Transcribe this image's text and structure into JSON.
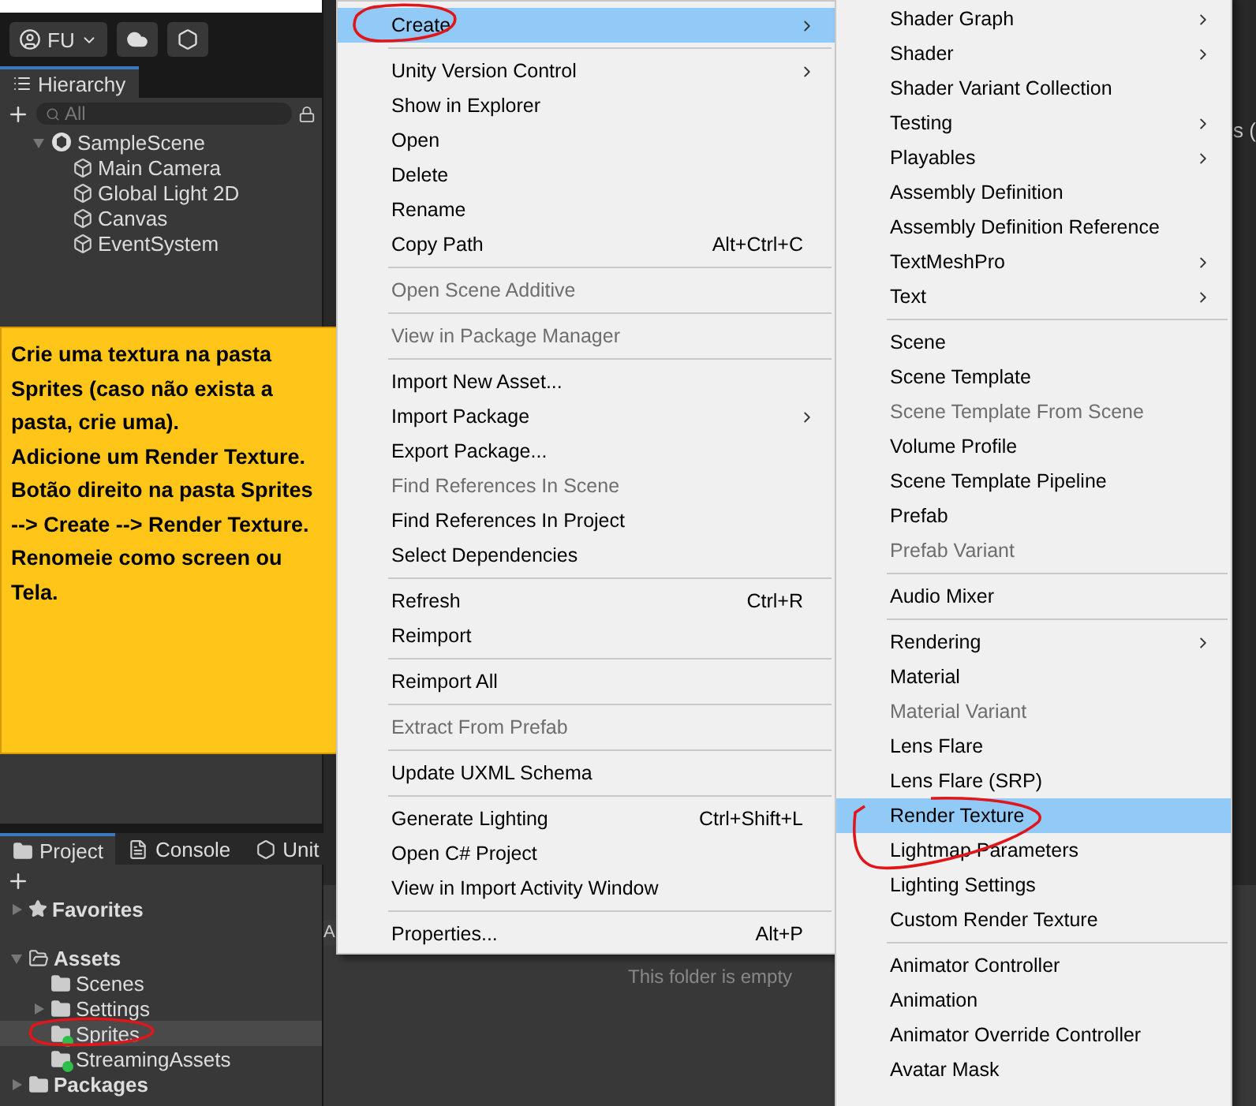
{
  "toolbar": {
    "account": "FU"
  },
  "hierarchy": {
    "tab": "Hierarchy",
    "search": {
      "placeholder": "All"
    },
    "tree": [
      {
        "label": "SampleScene",
        "kind": "scene",
        "expanded": true,
        "children": [
          {
            "label": "Main Camera",
            "kind": "object"
          },
          {
            "label": "Global Light 2D",
            "kind": "object"
          },
          {
            "label": "Canvas",
            "kind": "object"
          },
          {
            "label": "EventSystem",
            "kind": "object"
          }
        ]
      }
    ]
  },
  "note": {
    "paragraphs": [
      "Crie uma textura na pasta Sprites (caso não exista a pasta, crie uma).",
      "Adicione um Render Texture.",
      "Botão direito na pasta Sprites --> Create --> Render Texture.",
      "Renomeie como screen ou Tela."
    ]
  },
  "project": {
    "tabs": [
      {
        "label": "Project",
        "selected": true
      },
      {
        "label": "Console",
        "selected": false
      },
      {
        "label": "Unit",
        "selected": false
      }
    ],
    "tree": [
      {
        "label": "Favorites",
        "kind": "star",
        "expanded": false,
        "selected": false
      },
      {
        "label": "Assets",
        "kind": "folder",
        "expanded": true,
        "selected": false,
        "children": [
          {
            "label": "Scenes",
            "kind": "folder",
            "selected": false
          },
          {
            "label": "Settings",
            "kind": "folder",
            "expanded": false,
            "selected": false
          },
          {
            "label": "Sprites",
            "kind": "folder",
            "selected": true,
            "badge": true
          },
          {
            "label": "StreamingAssets",
            "kind": "folder",
            "selected": false,
            "badge": true
          }
        ]
      },
      {
        "label": "Packages",
        "kind": "folder",
        "expanded": false,
        "selected": false
      }
    ],
    "side_header": "A",
    "empty_message": "This folder is empty"
  },
  "scene_view": {
    "tab_fragment": "s ("
  },
  "context_menu": {
    "groups": [
      [
        {
          "label": "Create",
          "submenu": true,
          "selected": true,
          "disabled": false
        }
      ],
      [
        {
          "label": "Unity Version Control",
          "submenu": true,
          "selected": false,
          "disabled": false
        },
        {
          "label": "Show in Explorer",
          "selected": false,
          "disabled": false
        },
        {
          "label": "Open",
          "selected": false,
          "disabled": false
        },
        {
          "label": "Delete",
          "selected": false,
          "disabled": false
        },
        {
          "label": "Rename",
          "selected": false,
          "disabled": false
        },
        {
          "label": "Copy Path",
          "shortcut": "Alt+Ctrl+C",
          "selected": false,
          "disabled": false
        }
      ],
      [
        {
          "label": "Open Scene Additive",
          "selected": false,
          "disabled": true
        }
      ],
      [
        {
          "label": "View in Package Manager",
          "selected": false,
          "disabled": true
        }
      ],
      [
        {
          "label": "Import New Asset...",
          "selected": false,
          "disabled": false
        },
        {
          "label": "Import Package",
          "submenu": true,
          "selected": false,
          "disabled": false
        },
        {
          "label": "Export Package...",
          "selected": false,
          "disabled": false
        },
        {
          "label": "Find References In Scene",
          "selected": false,
          "disabled": true
        },
        {
          "label": "Find References In Project",
          "selected": false,
          "disabled": false
        },
        {
          "label": "Select Dependencies",
          "selected": false,
          "disabled": false
        }
      ],
      [
        {
          "label": "Refresh",
          "shortcut": "Ctrl+R",
          "selected": false,
          "disabled": false
        },
        {
          "label": "Reimport",
          "selected": false,
          "disabled": false
        }
      ],
      [
        {
          "label": "Reimport All",
          "selected": false,
          "disabled": false
        }
      ],
      [
        {
          "label": "Extract From Prefab",
          "selected": false,
          "disabled": true
        }
      ],
      [
        {
          "label": "Update UXML Schema",
          "selected": false,
          "disabled": false
        }
      ],
      [
        {
          "label": "Generate Lighting",
          "shortcut": "Ctrl+Shift+L",
          "selected": false,
          "disabled": false
        },
        {
          "label": "Open C# Project",
          "selected": false,
          "disabled": false
        },
        {
          "label": "View in Import Activity Window",
          "selected": false,
          "disabled": false
        }
      ],
      [
        {
          "label": "Properties...",
          "shortcut": "Alt+P",
          "selected": false,
          "disabled": false
        }
      ]
    ]
  },
  "create_submenu": {
    "groups": [
      [
        {
          "label": "Shader Graph",
          "submenu": true,
          "selected": false,
          "disabled": false
        },
        {
          "label": "Shader",
          "submenu": true,
          "selected": false,
          "disabled": false
        },
        {
          "label": "Shader Variant Collection",
          "selected": false,
          "disabled": false
        },
        {
          "label": "Testing",
          "submenu": true,
          "selected": false,
          "disabled": false
        },
        {
          "label": "Playables",
          "submenu": true,
          "selected": false,
          "disabled": false
        },
        {
          "label": "Assembly Definition",
          "selected": false,
          "disabled": false
        },
        {
          "label": "Assembly Definition Reference",
          "selected": false,
          "disabled": false
        },
        {
          "label": "TextMeshPro",
          "submenu": true,
          "selected": false,
          "disabled": false
        },
        {
          "label": "Text",
          "submenu": true,
          "selected": false,
          "disabled": false
        }
      ],
      [
        {
          "label": "Scene",
          "selected": false,
          "disabled": false
        },
        {
          "label": "Scene Template",
          "selected": false,
          "disabled": false
        },
        {
          "label": "Scene Template From Scene",
          "selected": false,
          "disabled": true
        },
        {
          "label": "Volume Profile",
          "selected": false,
          "disabled": false
        },
        {
          "label": "Scene Template Pipeline",
          "selected": false,
          "disabled": false
        },
        {
          "label": "Prefab",
          "selected": false,
          "disabled": false
        },
        {
          "label": "Prefab Variant",
          "selected": false,
          "disabled": true
        }
      ],
      [
        {
          "label": "Audio Mixer",
          "selected": false,
          "disabled": false
        }
      ],
      [
        {
          "label": "Rendering",
          "submenu": true,
          "selected": false,
          "disabled": false
        },
        {
          "label": "Material",
          "selected": false,
          "disabled": false
        },
        {
          "label": "Material Variant",
          "selected": false,
          "disabled": true
        },
        {
          "label": "Lens Flare",
          "selected": false,
          "disabled": false
        },
        {
          "label": "Lens Flare (SRP)",
          "selected": false,
          "disabled": false
        },
        {
          "label": "Render Texture",
          "selected": true,
          "disabled": false
        },
        {
          "label": "Lightmap Parameters",
          "selected": false,
          "disabled": false
        },
        {
          "label": "Lighting Settings",
          "selected": false,
          "disabled": false
        },
        {
          "label": "Custom Render Texture",
          "selected": false,
          "disabled": false
        }
      ],
      [
        {
          "label": "Animator Controller",
          "selected": false,
          "disabled": false
        },
        {
          "label": "Animation",
          "selected": false,
          "disabled": false
        },
        {
          "label": "Animator Override Controller",
          "selected": false,
          "disabled": false
        },
        {
          "label": "Avatar Mask",
          "selected": false,
          "disabled": false
        }
      ]
    ]
  }
}
